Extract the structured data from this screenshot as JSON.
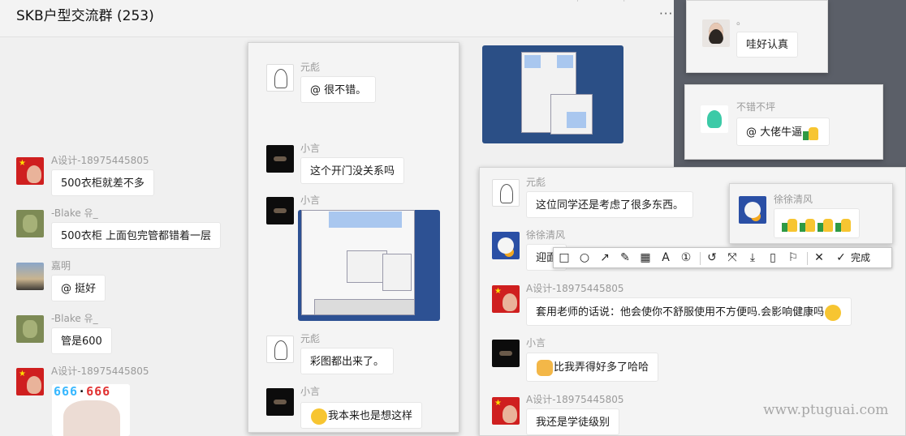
{
  "header": {
    "title": "SKB户型交流群 (253)",
    "more": "···"
  },
  "left": [
    {
      "name": "A设计-18975445805",
      "text": "500衣柜就差不多"
    },
    {
      "name": "-Blake 유_",
      "text": "500衣柜  上面包完管都错着一层"
    },
    {
      "name": "嘉明",
      "text": "@          挺好"
    },
    {
      "name": "-Blake 유_",
      "text": "管是600"
    },
    {
      "name": "A设计-18975445805",
      "meme_left": "666",
      "meme_sep": "·",
      "meme_right": "666"
    }
  ],
  "panel_mid": [
    {
      "name": "元彪",
      "text": "@          很不错。"
    },
    {
      "name": "小言",
      "text": "这个开门没关系吗"
    },
    {
      "name": "小言"
    },
    {
      "name": "元彪",
      "text": "彩图都出来了。"
    },
    {
      "name": "小言",
      "text": "我本来也是想这样"
    }
  ],
  "panel_right": [
    {
      "name": "元彪",
      "text": "这位同学还是考虑了很多东西。"
    },
    {
      "name": "徐徐清风",
      "text": "迎面"
    },
    {
      "name": "A设计-18975445805",
      "text": "套用老师的话说：他会使你不舒服使用不方便吗.会影响健康吗"
    },
    {
      "name": "小言",
      "text": "比我弄得好多了哈哈"
    },
    {
      "name": "A设计-18975445805",
      "text": "我还是学徒级别"
    }
  ],
  "panel_top_right": {
    "name": "。",
    "text": "哇好认真"
  },
  "panel_mid_right": {
    "name": "不错不坪",
    "text": "@          大佬牛逼"
  },
  "panel_float": {
    "name": "徐徐清风"
  },
  "toolbar": {
    "done": "完成"
  },
  "watermark": "www.ptuguai.com"
}
